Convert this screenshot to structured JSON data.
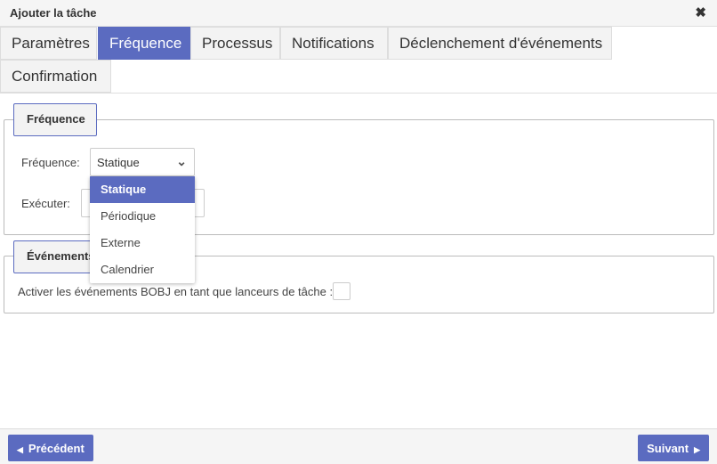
{
  "dialog": {
    "title": "Ajouter la tâche",
    "close_icon": "close-icon"
  },
  "tabs": [
    {
      "label": "Paramètres"
    },
    {
      "label": "Fréquence",
      "active": true
    },
    {
      "label": "Processus"
    },
    {
      "label": "Notifications"
    },
    {
      "label": "Déclenchement d'événements"
    },
    {
      "label": "Confirmation"
    }
  ],
  "frequency_section": {
    "legend": "Fréquence",
    "frequency_label": "Fréquence:",
    "frequency_value": "Statique",
    "execute_label": "Exécuter:",
    "options": [
      "Statique",
      "Périodique",
      "Externe",
      "Calendrier"
    ]
  },
  "events_section": {
    "legend": "Événements",
    "bobj_label": "Activer les événements BOBJ en tant que lanceurs de tâche :",
    "bobj_checked": false
  },
  "footer": {
    "previous_label": "Précédent",
    "next_label": "Suivant"
  },
  "colors": {
    "accent": "#5b6bc0"
  }
}
